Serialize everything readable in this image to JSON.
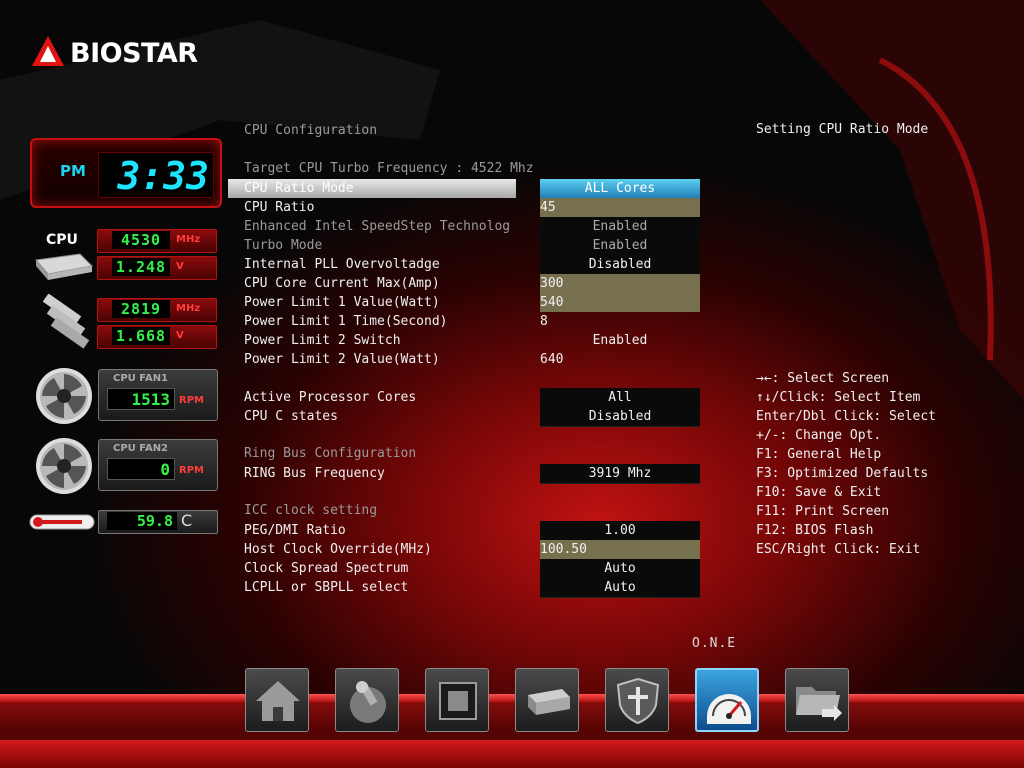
{
  "brand": "BIOSTAR",
  "monitor": {
    "clock": {
      "ampm": "PM",
      "time": "3:33"
    },
    "cpu_label": "CPU",
    "cpu_freq": {
      "value": "4530",
      "unit": "MHz"
    },
    "cpu_volt": {
      "value": "1.248",
      "unit": "V"
    },
    "mem_freq": {
      "value": "2819",
      "unit": "MHz"
    },
    "mem_volt": {
      "value": "1.668",
      "unit": "V"
    },
    "fan1": {
      "title": "CPU FAN1",
      "value": "1513",
      "unit": "RPM"
    },
    "fan2": {
      "title": "CPU FAN2",
      "value": "0",
      "unit": "RPM"
    },
    "temp": {
      "value": "59.8",
      "unit": "C"
    }
  },
  "config": {
    "title": "CPU Configuration",
    "target_turbo": "Target CPU Turbo Frequency : 4522 Mhz",
    "rows": [
      {
        "label": "CPU Ratio Mode",
        "value": "ALL Cores"
      },
      {
        "label": "CPU Ratio",
        "value": "45"
      },
      {
        "label": "Enhanced Intel SpeedStep Technolog",
        "value": "Enabled"
      },
      {
        "label": "Turbo Mode",
        "value": "Enabled"
      },
      {
        "label": "Internal PLL Overvoltadge",
        "value": "Disabled"
      },
      {
        "label": "CPU Core Current Max(Amp)",
        "value": "300"
      },
      {
        "label": "Power Limit 1 Value(Watt)",
        "value": "540"
      },
      {
        "label": "Power Limit 1 Time(Second)",
        "value": "8"
      },
      {
        "label": "Power Limit 2 Switch",
        "value": "Enabled"
      },
      {
        "label": "Power Limit 2 Value(Watt)",
        "value": "640"
      },
      {
        "label": "Active Processor Cores",
        "value": "All"
      },
      {
        "label": "CPU C states",
        "value": "Disabled"
      },
      {
        "label": "RING Bus Frequency",
        "value": "3919 Mhz"
      },
      {
        "label": "PEG/DMI Ratio",
        "value": "1.00"
      },
      {
        "label": "Host Clock Override(MHz)",
        "value": "100.50"
      },
      {
        "label": "Clock Spread Spectrum",
        "value": "Auto"
      },
      {
        "label": "LCPLL or SBPLL select",
        "value": "Auto"
      }
    ],
    "ring_title": "Ring Bus Configuration",
    "icc_title": "ICC clock setting"
  },
  "help": {
    "title": "Setting CPU Ratio Mode",
    "keys": [
      "→←: Select Screen",
      "↑↓/Click: Select Item",
      "Enter/Dbl Click: Select",
      "+/-: Change Opt.",
      "F1: General Help",
      "F3: Optimized Defaults",
      "F10: Save & Exit",
      "F11: Print Screen",
      "F12: BIOS Flash",
      "ESC/Right Click: Exit"
    ]
  },
  "toolbar": {
    "active_label": "O.N.E",
    "items": [
      "home-icon",
      "joystick-icon",
      "chip-icon",
      "drive-icon",
      "shield-cross-icon",
      "speedometer-icon",
      "folder-exit-icon"
    ]
  },
  "colors": {
    "accent": "#1de4ff",
    "highlight": "#3aa4e0",
    "led_green": "#35f04a",
    "brand_red": "#c41010"
  }
}
